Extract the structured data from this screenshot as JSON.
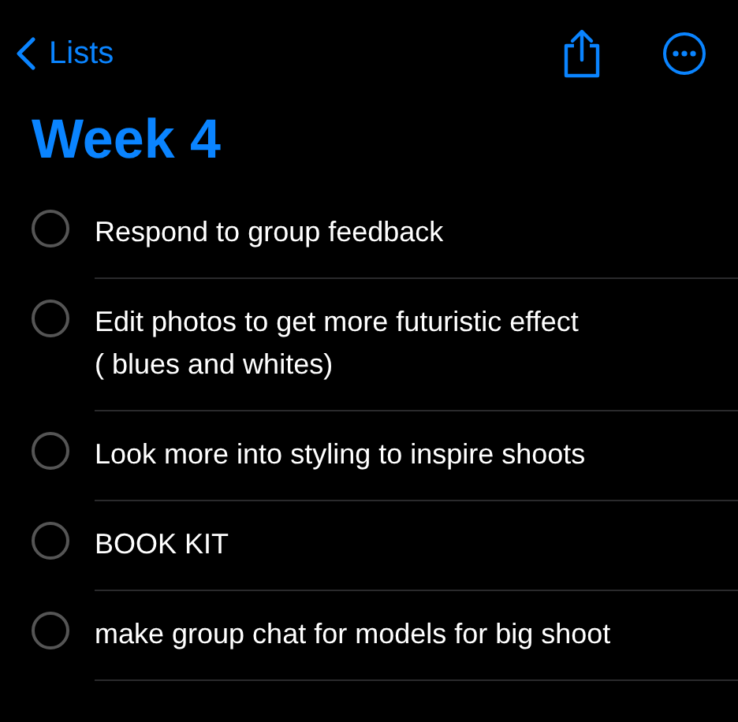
{
  "nav": {
    "back_label": "Lists"
  },
  "title": "Week 4",
  "items": [
    {
      "text": "Respond to group feedback",
      "checked": false
    },
    {
      "text": "Edit photos to get more futuristic effect\n( blues and whites)",
      "checked": false
    },
    {
      "text": "Look more into styling to inspire shoots",
      "checked": false
    },
    {
      "text": "BOOK KIT",
      "checked": false
    },
    {
      "text": "make group chat for models for big shoot",
      "checked": false
    }
  ]
}
